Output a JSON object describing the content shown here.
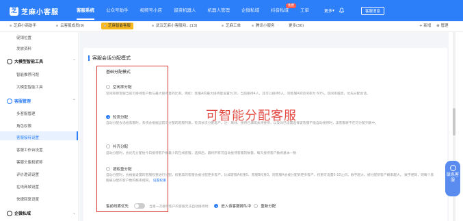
{
  "app": {
    "name": "芝麻小客服",
    "logo_char": "芝"
  },
  "nav": {
    "items": [
      "客服系统",
      "公众号助手",
      "视频号小店",
      "留资机器人",
      "机器人管理",
      "企微私域",
      "抖音私域",
      "工单"
    ],
    "active_index": 0,
    "new_badge": "免费",
    "more": "更多",
    "contact": "客服消息"
  },
  "tabs": {
    "items": [
      "芝麻小商助手",
      "云客服成员(9)",
      "芝麻智能客服",
      "武汉芝麻小客服网...(13)",
      "芝麻工单",
      "腾讯小服务",
      "更多(30)"
    ],
    "active_index": 2,
    "new_label": "+ 新增",
    "manage_label": "⊕ 管理"
  },
  "sidebar": {
    "top_items": [
      "促销位置",
      "发放资料"
    ],
    "groups": [
      {
        "label": "大模型智能工具",
        "items": [
          "智能推荐问题",
          "大模型智能工具"
        ]
      },
      {
        "label": "客服管理",
        "items": [
          "多客服管理",
          "角色权限",
          "客服接待设置",
          "客服工作台设置",
          "客服头像和昵称",
          "评价邀请设置",
          "在线商城设置",
          "快捷回复设置"
        ]
      },
      {
        "label": "企微私域",
        "items": []
      }
    ],
    "active_item": "客服接待设置"
  },
  "main": {
    "section_title": "客服会话分配模式",
    "sub_title": "基础分配模式",
    "options": [
      {
        "label": "空闲率分配",
        "checked": false,
        "desc": "空闲率即客服当前可接待客户数与最大接待量的比率。例如：客服A的最大接待量设置为10，当前接待4人，还可以接待6人，则客服A的空闲率为 60%。空闲率越高，优先分配会话。"
      },
      {
        "label": "轮流分配",
        "checked": true,
        "desc": "自动分配会话给客服时，系统会根据当前可分配的客服列表，轮流依次分配客户。注：离线、接待已满或关闭接待，以及对已设置选择该客服不能自动接待时，该客服将不在可分配列表中。"
      },
      {
        "label": "补齐分配",
        "checked": false,
        "desc": "自动分配时，会优先分配给今日接待客户数最少的在线客服，选择后，最终所有可自动接待客服的数量，每天接待客户数将基本一致"
      },
      {
        "label": "按权重分配",
        "checked": false,
        "desc": "自动分配时，会根据设置的客服权重进行分配，权重高的客服会被分配更多客户。比如客服A权重5、客服B权重3，则客服A会被分配到更多客户，权重可设置0-10之间，数字越大，被分配到客户概率越大。",
        "desc2": "数字相同，则每个客服被分配的客户数的概率相同。",
        "link": "设置权重"
      }
    ],
    "annotation": "可智能分配客服",
    "pre_sale": {
      "label": "售前线索优先",
      "hint": "当第一次接待客户的客服无法自动接待时：",
      "radio1": "进入该客服排队中",
      "radio2": "重新分配"
    }
  },
  "float_help": {
    "label": "联系客服"
  },
  "colors": {
    "primary": "#2d7ff9",
    "accent_tab": "#f7b91f",
    "annotation": "#e24b43"
  }
}
